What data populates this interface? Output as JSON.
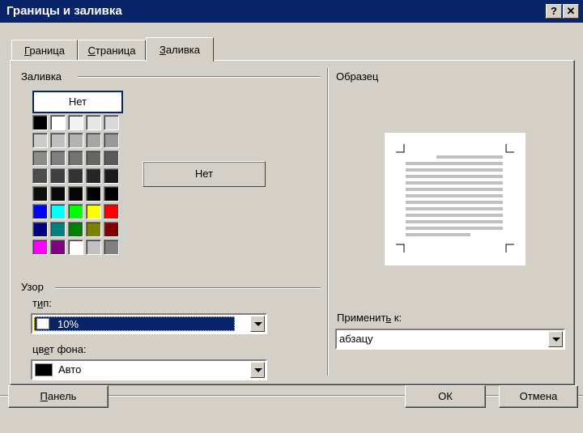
{
  "window": {
    "title": "Границы и заливка",
    "help_label": "?",
    "close_label": "✕"
  },
  "tabs": [
    {
      "label_pre": "",
      "label_key": "Г",
      "label_post": "раница"
    },
    {
      "label_pre": "",
      "label_key": "С",
      "label_post": "траница"
    },
    {
      "label_pre": "",
      "label_key": "З",
      "label_post": "аливка"
    }
  ],
  "fill": {
    "group_label": "Заливка",
    "none_button": "Нет",
    "selected_preview_label": "Нет",
    "palette": [
      [
        "#000000",
        "#ffffff",
        "#f2f2f2",
        "#e6e6e6",
        "#d9d9d9"
      ],
      [
        "#cccccc",
        "#bfbfbf",
        "#b3b3b3",
        "#a6a6a6",
        "#999999"
      ],
      [
        "#8c8c8c",
        "#808080",
        "#737373",
        "#666666",
        "#595959"
      ],
      [
        "#4d4d4d",
        "#404040",
        "#333333",
        "#262626",
        "#1a1a1a"
      ],
      [
        "#0d0d0d",
        "#0a0a0a",
        "#050505",
        "#030303",
        "#000000"
      ],
      [
        "#0000ff",
        "#00ffff",
        "#00ff00",
        "#ffff00",
        "#ff0000"
      ],
      [
        "#000080",
        "#008080",
        "#008000",
        "#808000",
        "#800000"
      ],
      [
        "#ff00ff",
        "#800080",
        "#ffffff",
        "#c0c0c0",
        "#808080"
      ]
    ]
  },
  "pattern": {
    "group_label": "Узор",
    "type_label_pre": "т",
    "type_label_key": "и",
    "type_label_post": "п:",
    "type_value": "10%",
    "type_swatch_color": "#ffffff",
    "bg_label_pre": "цв",
    "bg_label_key": "е",
    "bg_label_post": "т фона:",
    "bg_value": "Авто",
    "bg_swatch_color": "#000000"
  },
  "sample": {
    "group_label": "Образец",
    "apply_label_pre": "Применит",
    "apply_label_key": "ь",
    "apply_label_post": " к:",
    "apply_value": "абзацу"
  },
  "buttons": {
    "panel_pre": "",
    "panel_key": "П",
    "panel_post": "анель",
    "ok": "ОК",
    "cancel": "Отмена"
  }
}
